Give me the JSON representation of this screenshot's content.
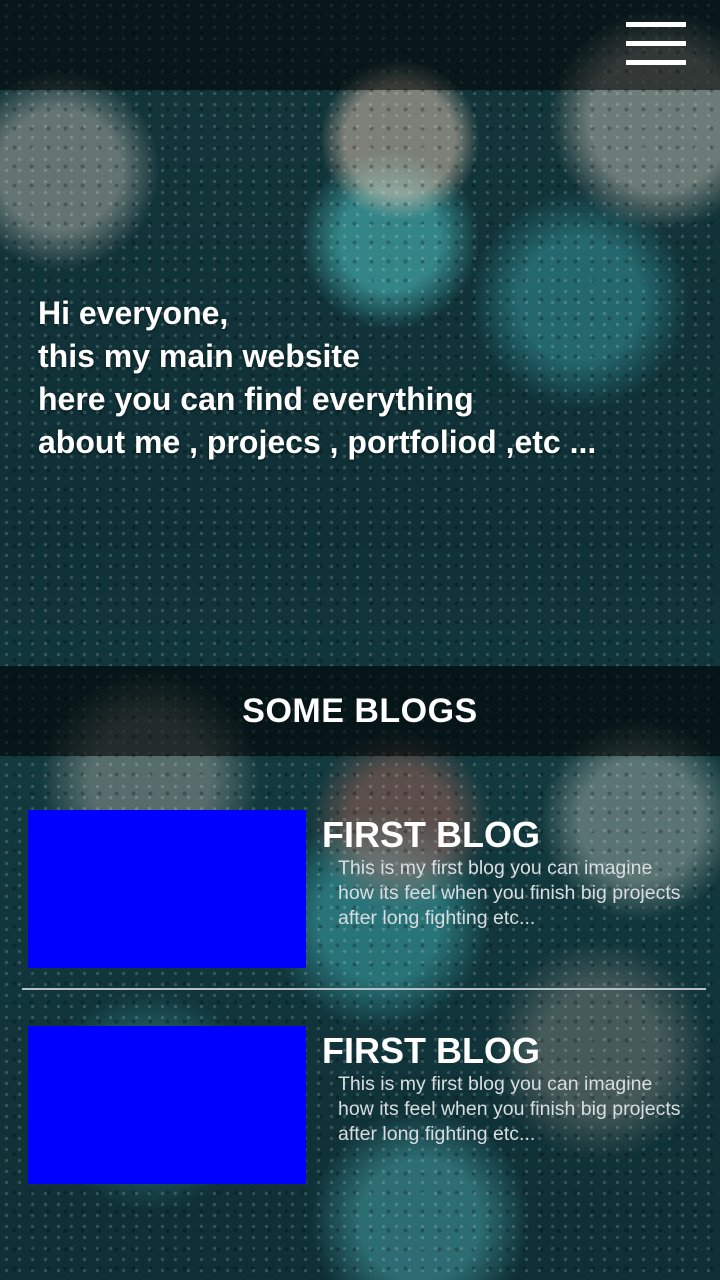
{
  "header": {
    "menu_icon": "hamburger-menu-icon"
  },
  "hero": {
    "lines": [
      "Hi everyone,",
      "this my main website",
      "here you can find everything",
      "about me , projecs , portfoliod ,etc ..."
    ]
  },
  "blogs_section": {
    "heading": "SOME BLOGS",
    "items": [
      {
        "title": "FIRST BLOG",
        "excerpt_lines": [
          "This is my first blog you can imagine",
          "how its feel when you finish big projects",
          "after long fighting etc..."
        ],
        "thumbnail_color": "#0000ff"
      },
      {
        "title": "FIRST BLOG",
        "excerpt_lines": [
          "This is my first blog you can imagine",
          "how its feel when you finish big projects",
          "after long fighting etc..."
        ],
        "thumbnail_color": "#0000ff"
      }
    ]
  }
}
